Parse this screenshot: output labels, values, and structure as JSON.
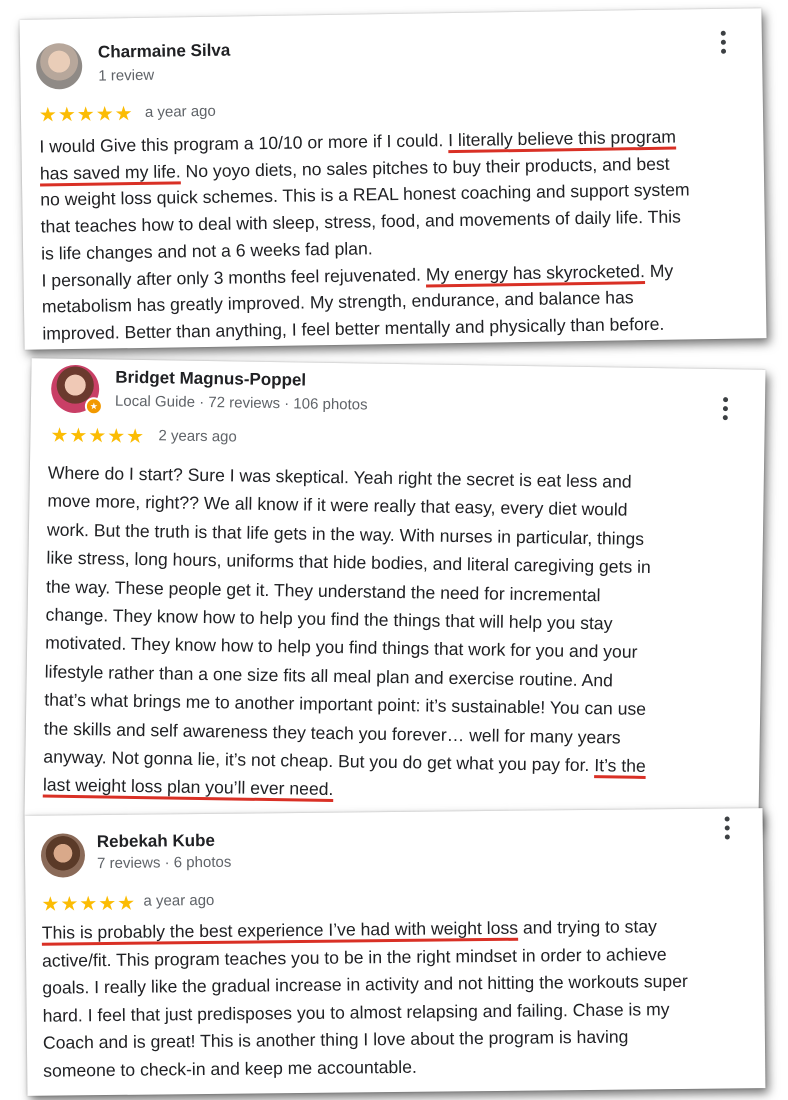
{
  "reviews": [
    {
      "name": "Charmaine Silva",
      "meta": "1 review",
      "stars": "★★★★★",
      "ago": "a year ago",
      "lines": [
        [
          "I would Give this program a 10/10 or more if I could. ",
          "I literally believe this program"
        ],
        [
          "has saved my life.",
          " No yoyo diets, no sales pitches to buy their products, and best"
        ],
        [
          "no weight loss quick schemes. This is a REAL honest coaching and support system"
        ],
        [
          "that teaches how to deal with sleep, stress, food, and movements of daily life. This"
        ],
        [
          "is life changes and not a 6 weeks fad plan."
        ],
        [
          "I personally after only 3 months feel rejuvenated. ",
          "My energy has skyrocketed.",
          " My"
        ],
        [
          "metabolism has greatly improved. My strength, endurance, and balance has"
        ],
        [
          "improved. Better than anything, I feel better mentally and physically than before."
        ]
      ]
    },
    {
      "name": "Bridget Magnus-Poppel",
      "meta": "Local Guide · 72 reviews · 106 photos",
      "stars": "★★★★★",
      "ago": "2 years ago",
      "lines": [
        [
          "Where do I start? Sure I was skeptical. Yeah right the secret is eat less and"
        ],
        [
          "move more, right?? We all know if it were really that easy, every diet would"
        ],
        [
          "work. But the truth is that life gets in the way. With nurses in particular, things"
        ],
        [
          "like stress, long hours, uniforms that hide bodies, and literal caregiving gets in"
        ],
        [
          "the way. These people get it. They understand the need for incremental"
        ],
        [
          "change. They know how to help you find the things that will help you stay"
        ],
        [
          "motivated. They know how to help you find things that work for you and your"
        ],
        [
          "lifestyle rather than a one size fits all meal plan and exercise routine. And"
        ],
        [
          "that’s what brings me to another important point: it’s sustainable! You can use"
        ],
        [
          "the skills and self awareness they teach you forever… well for many years"
        ],
        [
          "anyway. Not gonna lie, it’s not cheap. But you do get what you pay for. ",
          "It’s the"
        ],
        [
          "",
          "last weight loss plan you’ll ever need."
        ]
      ]
    },
    {
      "name": "Rebekah Kube",
      "meta": "7 reviews · 6 photos",
      "stars": "★★★★★",
      "ago": "a year ago",
      "lines": [
        [
          "",
          "This is probably the best experience I’ve had with weight loss",
          " and trying to stay"
        ],
        [
          "active/fit. This program teaches you to be in the right mindset in order to achieve"
        ],
        [
          "goals. I really like the gradual increase in activity and not hitting the workouts super"
        ],
        [
          "hard. I feel that just predisposes you to almost relapsing and failing. Chase is my"
        ],
        [
          "Coach and is great! This is another thing I love about the program is having"
        ],
        [
          "someone to check-in and keep me accountable."
        ]
      ]
    }
  ],
  "colors": {
    "star": "#fbbc04",
    "underline": "#d93025",
    "badge": "#f29900"
  },
  "icons": [
    "avatar",
    "local-guide-badge-icon",
    "more-options-icon",
    "star-icon"
  ]
}
